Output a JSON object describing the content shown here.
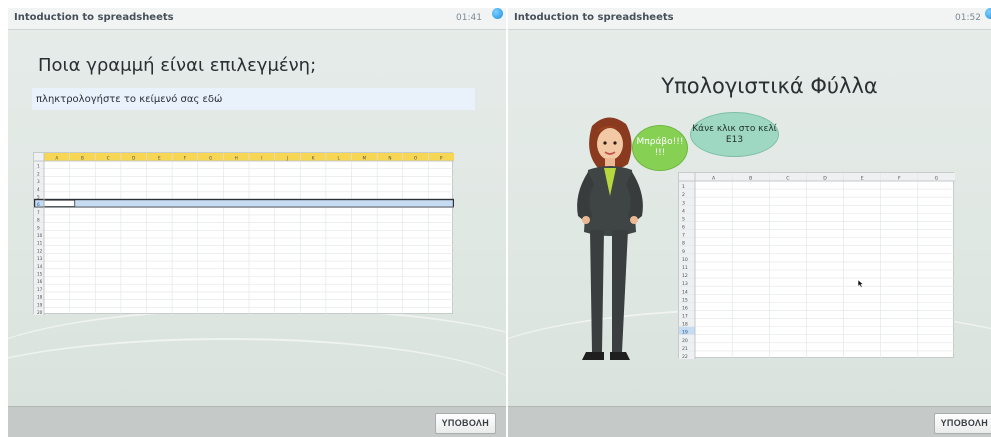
{
  "left": {
    "course_title": "Intoduction to spreadsheets",
    "timer": "01:41",
    "question": "Ποια γραμμή είναι επιλεγμένη;",
    "answer_placeholder": "πληκτρολογήστε το κείμενό σας εδώ",
    "submit_label": "ΥΠΟΒΟΛΗ",
    "sheet": {
      "columns": [
        "A",
        "B",
        "C",
        "D",
        "E",
        "F",
        "G",
        "H",
        "I",
        "J",
        "K",
        "L",
        "M",
        "N",
        "O",
        "P"
      ],
      "rows": [
        "1",
        "2",
        "3",
        "4",
        "5",
        "6",
        "7",
        "8",
        "9",
        "10",
        "11",
        "12",
        "13",
        "14",
        "15",
        "16",
        "17",
        "18",
        "19",
        "20"
      ],
      "selected_row": "6"
    }
  },
  "right": {
    "course_title": "Intoduction to spreadsheets",
    "timer": "01:52",
    "title": "Υπολογιστικά Φύλλα",
    "bubble_bravo": "Μπράβο!!! !!!",
    "bubble_hint": "Κάνε κλικ στο κελί E13",
    "submit_label": "ΥΠΟΒΟΛΗ",
    "sheet": {
      "columns": [
        "A",
        "B",
        "C",
        "D",
        "E",
        "F",
        "G"
      ],
      "rows": [
        "1",
        "2",
        "3",
        "4",
        "5",
        "6",
        "7",
        "8",
        "9",
        "10",
        "11",
        "12",
        "13",
        "14",
        "15",
        "16",
        "17",
        "18",
        "19",
        "20",
        "21",
        "22"
      ],
      "selected_row": "19"
    }
  },
  "colors": {
    "header_yellow": "#f7d654",
    "selection_blue": "#c6dcf2",
    "bravo_green": "#86d154",
    "hint_teal": "#9fd8c2",
    "timer_dot": "#1a8fe0"
  }
}
